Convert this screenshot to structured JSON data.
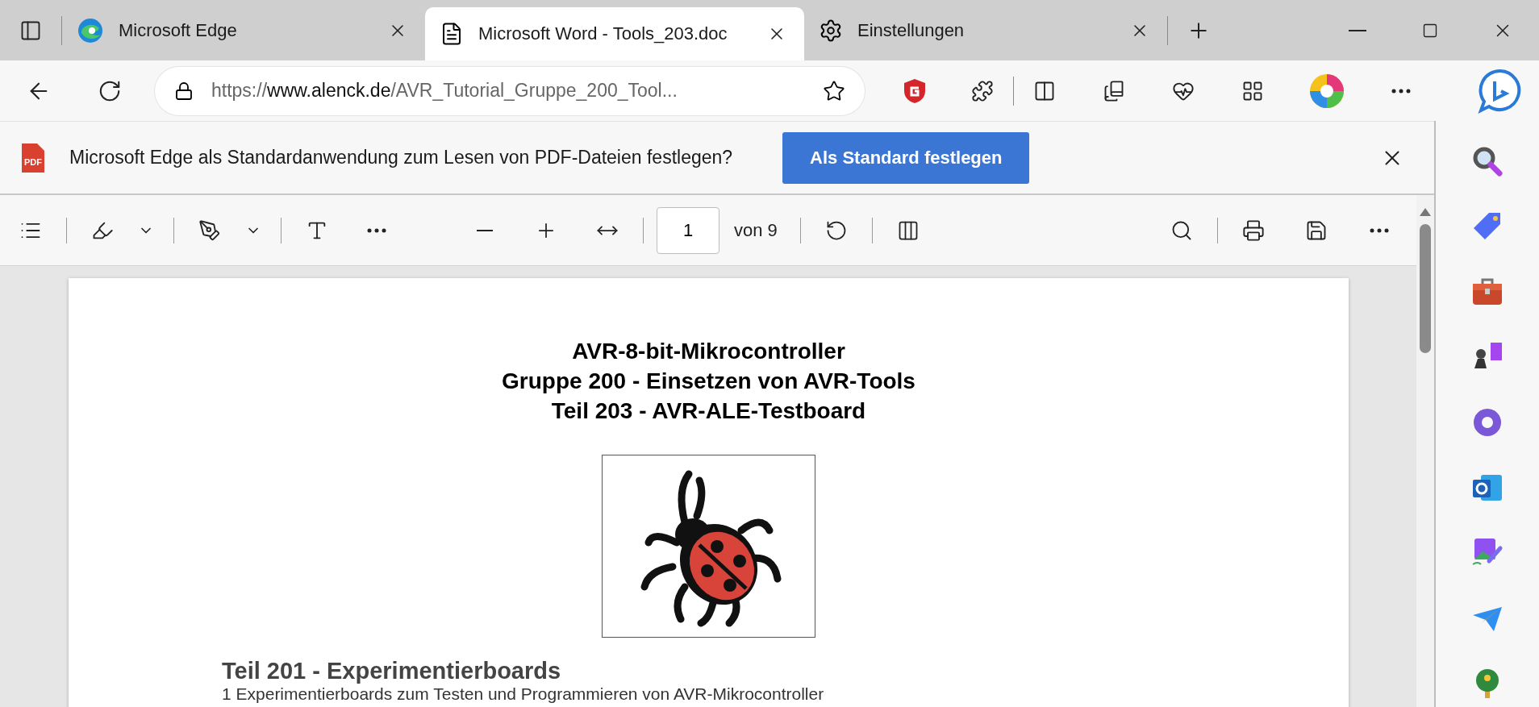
{
  "tabs": [
    {
      "title": "Microsoft Edge",
      "kind": "edge",
      "selected": false
    },
    {
      "title": "Microsoft Word - Tools_203.doc",
      "kind": "document",
      "selected": true
    },
    {
      "title": "Einstellungen",
      "kind": "settings",
      "selected": false
    }
  ],
  "address_bar": {
    "scheme": "https://",
    "host": "www.alenck.de",
    "path": "/AVR_Tutorial_Gruppe_200_Tool..."
  },
  "infobar": {
    "icon_label": "PDF",
    "message": "Microsoft Edge als Standardanwendung zum Lesen von PDF-Dateien festlegen?",
    "button": "Als Standard festlegen"
  },
  "pdf_toolbar": {
    "page": "1",
    "page_count": "von 9"
  },
  "document": {
    "title_lines": [
      "AVR-8-bit-Mikrocontroller",
      "Gruppe 200 - Einsetzen von AVR-Tools",
      "Teil 203 - AVR-ALE-Testboard"
    ],
    "heading": "Teil 201 - Experimentierboards",
    "body": "1 Experimentierboards zum Testen und Programmieren von AVR-Mikrocontroller"
  }
}
